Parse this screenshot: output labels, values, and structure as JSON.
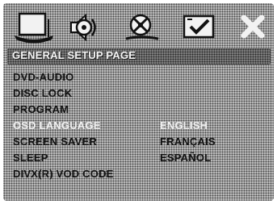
{
  "icons": [
    {
      "name": "general-setup-icon",
      "selected": true
    },
    {
      "name": "audio-setup-icon",
      "selected": false
    },
    {
      "name": "video-setup-icon",
      "selected": false
    },
    {
      "name": "preference-setup-icon",
      "selected": false
    },
    {
      "name": "exit-icon",
      "selected": false
    }
  ],
  "page_title": "GENERAL SETUP PAGE",
  "menu_items": [
    {
      "label": "DVD-AUDIO"
    },
    {
      "label": "DISC LOCK"
    },
    {
      "label": "PROGRAM"
    },
    {
      "label": "OSD LANGUAGE",
      "selected": true
    },
    {
      "label": "SCREEN SAVER"
    },
    {
      "label": "SLEEP"
    },
    {
      "label": "DIVX(R) VOD CODE"
    }
  ],
  "osd_language_options": [
    {
      "label": "ENGLISH",
      "selected": true
    },
    {
      "label": "FRANÇAIS"
    },
    {
      "label": "ESPAÑOL"
    }
  ]
}
